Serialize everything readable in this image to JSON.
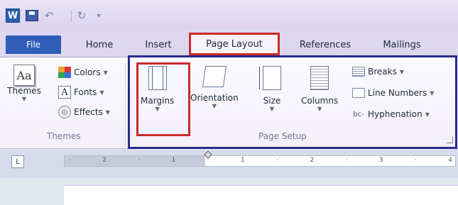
{
  "quick_access": {
    "app_icon_letter": "W",
    "undo_glyph": "↶",
    "redo_glyph": "↻",
    "customize_glyph": "▾"
  },
  "tabs": {
    "file": "File",
    "home": "Home",
    "insert": "Insert",
    "page_layout": "Page Layout",
    "references": "References",
    "mailings": "Mailings"
  },
  "themes_group": {
    "themes_icon_text": "Aa",
    "themes_label": "Themes",
    "colors_label": "Colors",
    "fonts_icon_text": "A",
    "fonts_label": "Fonts",
    "effects_label": "Effects",
    "caption": "Themes"
  },
  "page_setup_group": {
    "margins_label": "Margins",
    "orientation_label": "Orientation",
    "size_label": "Size",
    "columns_label": "Columns",
    "breaks_label": "Breaks",
    "line_numbers_label": "Line Numbers",
    "hyphenation_label": "Hyphenation",
    "caption": "Page Setup"
  },
  "ruler": {
    "tab_selector_glyph": "L",
    "marks": [
      "·",
      "2",
      "·",
      "1",
      "·",
      "1",
      "·",
      "2",
      "·",
      "3",
      "·",
      "4"
    ]
  },
  "highlights": {
    "page_layout_tab_color": "#c92b2d",
    "margins_color": "#c92b2d",
    "page_setup_color": "#2a2a8c"
  }
}
